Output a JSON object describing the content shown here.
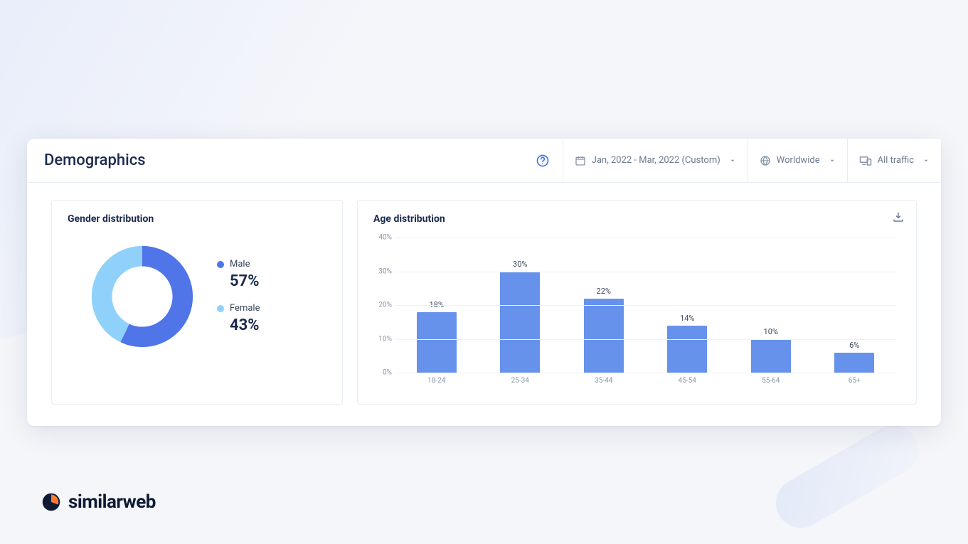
{
  "header": {
    "title": "Demographics",
    "date_range": "Jan, 2022 - Mar, 2022 (Custom)",
    "region": "Worldwide",
    "traffic": "All traffic"
  },
  "gender_card_title": "Gender distribution",
  "age_card_title": "Age distribution",
  "gender": {
    "male_label": "Male",
    "male_value": "57%",
    "female_label": "Female",
    "female_value": "43%",
    "colors": {
      "male": "#4f75e8",
      "female": "#8fd1fb"
    }
  },
  "age_y_ticks": [
    "0%",
    "10%",
    "20%",
    "30%",
    "40%"
  ],
  "logo": "similarweb",
  "chart_data": [
    {
      "type": "pie",
      "title": "Gender distribution",
      "categories": [
        "Male",
        "Female"
      ],
      "values": [
        57,
        43
      ],
      "colors": [
        "#4f75e8",
        "#8fd1fb"
      ]
    },
    {
      "type": "bar",
      "title": "Age distribution",
      "xlabel": "",
      "ylabel": "",
      "ylim": [
        0,
        40
      ],
      "categories": [
        "18-24",
        "25-34",
        "35-44",
        "45-54",
        "55-64",
        "65+"
      ],
      "values": [
        18,
        30,
        22,
        14,
        10,
        6
      ],
      "labels": [
        "18%",
        "30%",
        "22%",
        "14%",
        "10%",
        "6%"
      ],
      "color": "#6792ec"
    }
  ]
}
